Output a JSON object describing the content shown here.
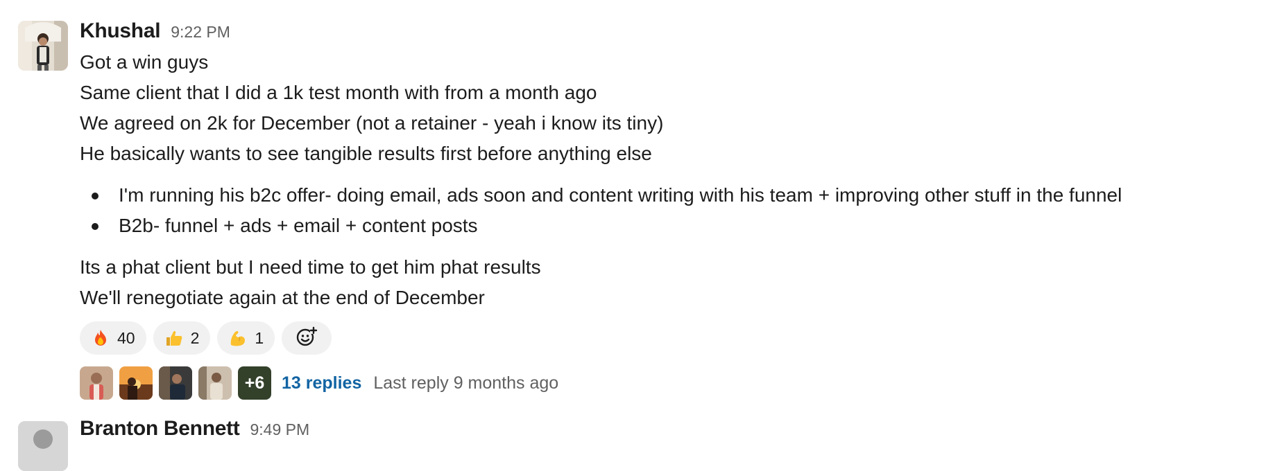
{
  "message": {
    "author": "Khushal",
    "time": "9:22 PM",
    "lines_before": [
      "Got a win guys",
      "Same client that I did a 1k test month with from a month ago",
      "We agreed on 2k for December (not a retainer - yeah i know its tiny)",
      "He basically wants to see tangible results first before anything else"
    ],
    "bullets": [
      "I'm running his b2c offer- doing email, ads soon and content writing with his team + improving other stuff in the funnel",
      "B2b- funnel + ads + email + content posts"
    ],
    "lines_after": [
      "Its a phat client but I need time to get him phat results",
      "We'll renegotiate again at the end of December"
    ]
  },
  "reactions": [
    {
      "emoji": "fire-emoji",
      "count": "40"
    },
    {
      "emoji": "thumbs-up-emoji",
      "count": "2"
    },
    {
      "emoji": "flexed-biceps-emoji",
      "count": "1"
    }
  ],
  "add_reaction_icon": "add-reaction-icon",
  "thread": {
    "more_count": "+6",
    "replies": "13 replies",
    "last_reply": "Last reply 9 months ago"
  },
  "next_message": {
    "author": "Branton Bennett",
    "time": "9:49 PM"
  },
  "colors": {
    "link": "#1264a3",
    "muted": "#616061",
    "reaction_bg": "#f1f1f1",
    "text": "#1d1c1d"
  }
}
